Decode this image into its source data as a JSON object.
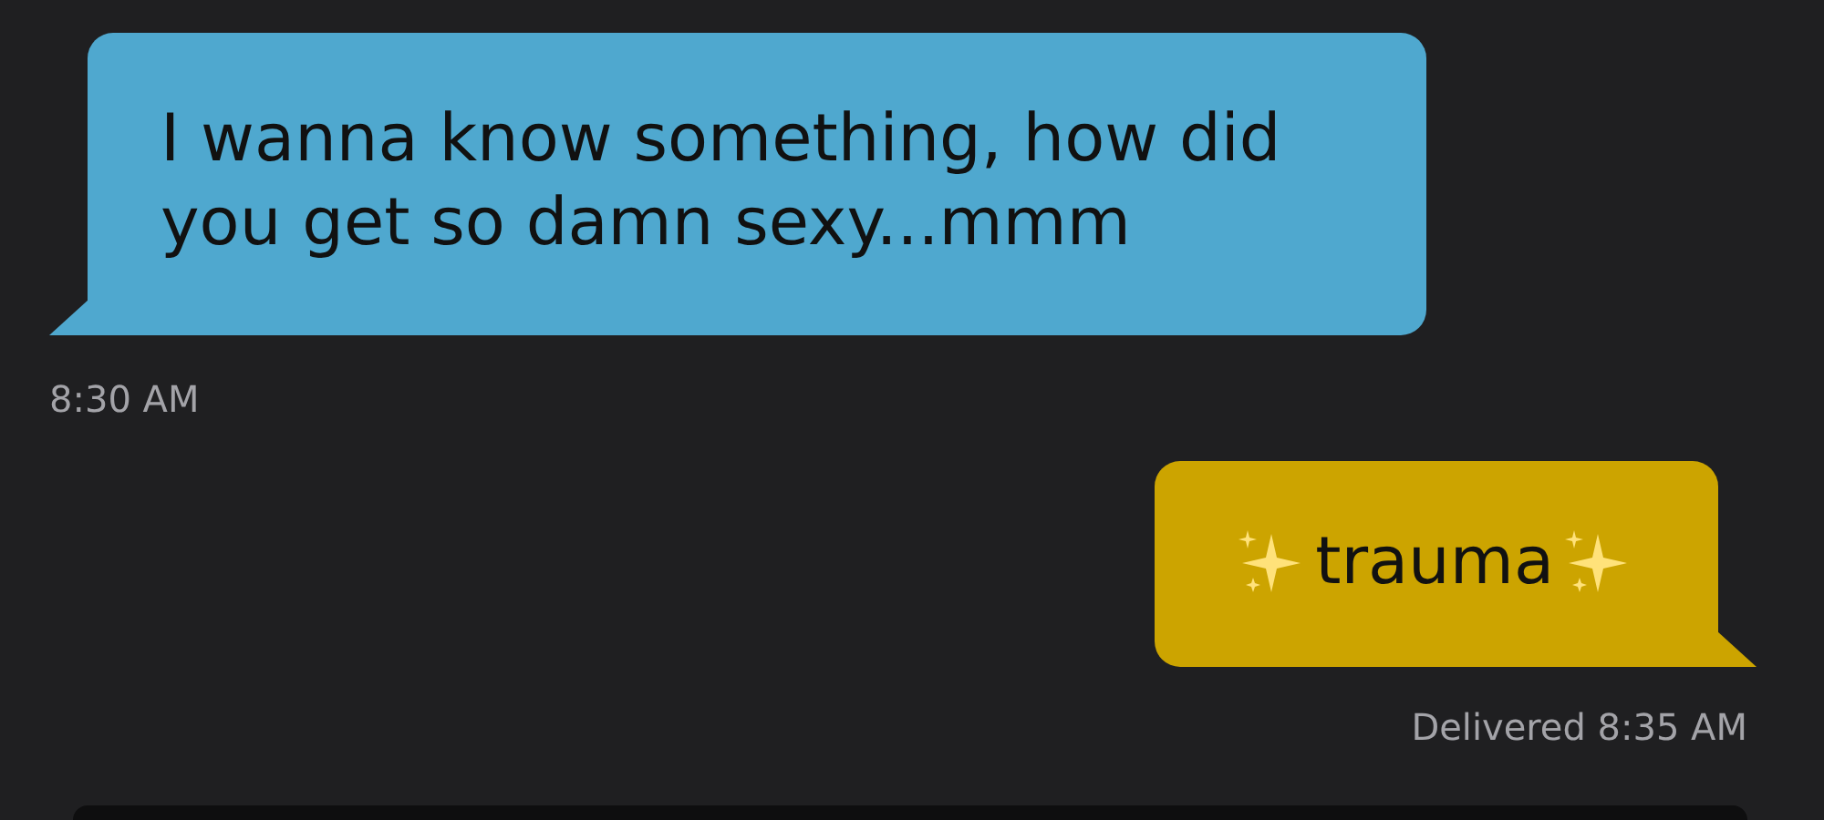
{
  "messages": [
    {
      "kind": "incoming",
      "text": "I wanna know something, how did you get so damn sexy...mmm",
      "time": "8:30 AM"
    },
    {
      "kind": "outgoing",
      "text": "trauma",
      "decorated": true,
      "status": "Delivered",
      "time": "8:35 AM"
    }
  ]
}
